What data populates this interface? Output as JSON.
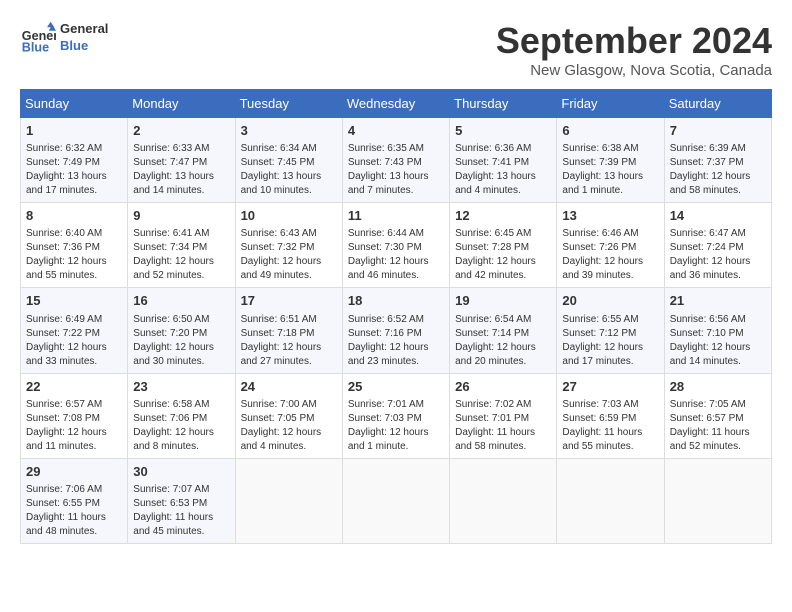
{
  "header": {
    "logo_line1": "General",
    "logo_line2": "Blue",
    "month": "September 2024",
    "location": "New Glasgow, Nova Scotia, Canada"
  },
  "weekdays": [
    "Sunday",
    "Monday",
    "Tuesday",
    "Wednesday",
    "Thursday",
    "Friday",
    "Saturday"
  ],
  "weeks": [
    [
      {
        "day": "1",
        "info": "Sunrise: 6:32 AM\nSunset: 7:49 PM\nDaylight: 13 hours and 17 minutes."
      },
      {
        "day": "2",
        "info": "Sunrise: 6:33 AM\nSunset: 7:47 PM\nDaylight: 13 hours and 14 minutes."
      },
      {
        "day": "3",
        "info": "Sunrise: 6:34 AM\nSunset: 7:45 PM\nDaylight: 13 hours and 10 minutes."
      },
      {
        "day": "4",
        "info": "Sunrise: 6:35 AM\nSunset: 7:43 PM\nDaylight: 13 hours and 7 minutes."
      },
      {
        "day": "5",
        "info": "Sunrise: 6:36 AM\nSunset: 7:41 PM\nDaylight: 13 hours and 4 minutes."
      },
      {
        "day": "6",
        "info": "Sunrise: 6:38 AM\nSunset: 7:39 PM\nDaylight: 13 hours and 1 minute."
      },
      {
        "day": "7",
        "info": "Sunrise: 6:39 AM\nSunset: 7:37 PM\nDaylight: 12 hours and 58 minutes."
      }
    ],
    [
      {
        "day": "8",
        "info": "Sunrise: 6:40 AM\nSunset: 7:36 PM\nDaylight: 12 hours and 55 minutes."
      },
      {
        "day": "9",
        "info": "Sunrise: 6:41 AM\nSunset: 7:34 PM\nDaylight: 12 hours and 52 minutes."
      },
      {
        "day": "10",
        "info": "Sunrise: 6:43 AM\nSunset: 7:32 PM\nDaylight: 12 hours and 49 minutes."
      },
      {
        "day": "11",
        "info": "Sunrise: 6:44 AM\nSunset: 7:30 PM\nDaylight: 12 hours and 46 minutes."
      },
      {
        "day": "12",
        "info": "Sunrise: 6:45 AM\nSunset: 7:28 PM\nDaylight: 12 hours and 42 minutes."
      },
      {
        "day": "13",
        "info": "Sunrise: 6:46 AM\nSunset: 7:26 PM\nDaylight: 12 hours and 39 minutes."
      },
      {
        "day": "14",
        "info": "Sunrise: 6:47 AM\nSunset: 7:24 PM\nDaylight: 12 hours and 36 minutes."
      }
    ],
    [
      {
        "day": "15",
        "info": "Sunrise: 6:49 AM\nSunset: 7:22 PM\nDaylight: 12 hours and 33 minutes."
      },
      {
        "day": "16",
        "info": "Sunrise: 6:50 AM\nSunset: 7:20 PM\nDaylight: 12 hours and 30 minutes."
      },
      {
        "day": "17",
        "info": "Sunrise: 6:51 AM\nSunset: 7:18 PM\nDaylight: 12 hours and 27 minutes."
      },
      {
        "day": "18",
        "info": "Sunrise: 6:52 AM\nSunset: 7:16 PM\nDaylight: 12 hours and 23 minutes."
      },
      {
        "day": "19",
        "info": "Sunrise: 6:54 AM\nSunset: 7:14 PM\nDaylight: 12 hours and 20 minutes."
      },
      {
        "day": "20",
        "info": "Sunrise: 6:55 AM\nSunset: 7:12 PM\nDaylight: 12 hours and 17 minutes."
      },
      {
        "day": "21",
        "info": "Sunrise: 6:56 AM\nSunset: 7:10 PM\nDaylight: 12 hours and 14 minutes."
      }
    ],
    [
      {
        "day": "22",
        "info": "Sunrise: 6:57 AM\nSunset: 7:08 PM\nDaylight: 12 hours and 11 minutes."
      },
      {
        "day": "23",
        "info": "Sunrise: 6:58 AM\nSunset: 7:06 PM\nDaylight: 12 hours and 8 minutes."
      },
      {
        "day": "24",
        "info": "Sunrise: 7:00 AM\nSunset: 7:05 PM\nDaylight: 12 hours and 4 minutes."
      },
      {
        "day": "25",
        "info": "Sunrise: 7:01 AM\nSunset: 7:03 PM\nDaylight: 12 hours and 1 minute."
      },
      {
        "day": "26",
        "info": "Sunrise: 7:02 AM\nSunset: 7:01 PM\nDaylight: 11 hours and 58 minutes."
      },
      {
        "day": "27",
        "info": "Sunrise: 7:03 AM\nSunset: 6:59 PM\nDaylight: 11 hours and 55 minutes."
      },
      {
        "day": "28",
        "info": "Sunrise: 7:05 AM\nSunset: 6:57 PM\nDaylight: 11 hours and 52 minutes."
      }
    ],
    [
      {
        "day": "29",
        "info": "Sunrise: 7:06 AM\nSunset: 6:55 PM\nDaylight: 11 hours and 48 minutes."
      },
      {
        "day": "30",
        "info": "Sunrise: 7:07 AM\nSunset: 6:53 PM\nDaylight: 11 hours and 45 minutes."
      },
      {
        "day": "",
        "info": ""
      },
      {
        "day": "",
        "info": ""
      },
      {
        "day": "",
        "info": ""
      },
      {
        "day": "",
        "info": ""
      },
      {
        "day": "",
        "info": ""
      }
    ]
  ]
}
